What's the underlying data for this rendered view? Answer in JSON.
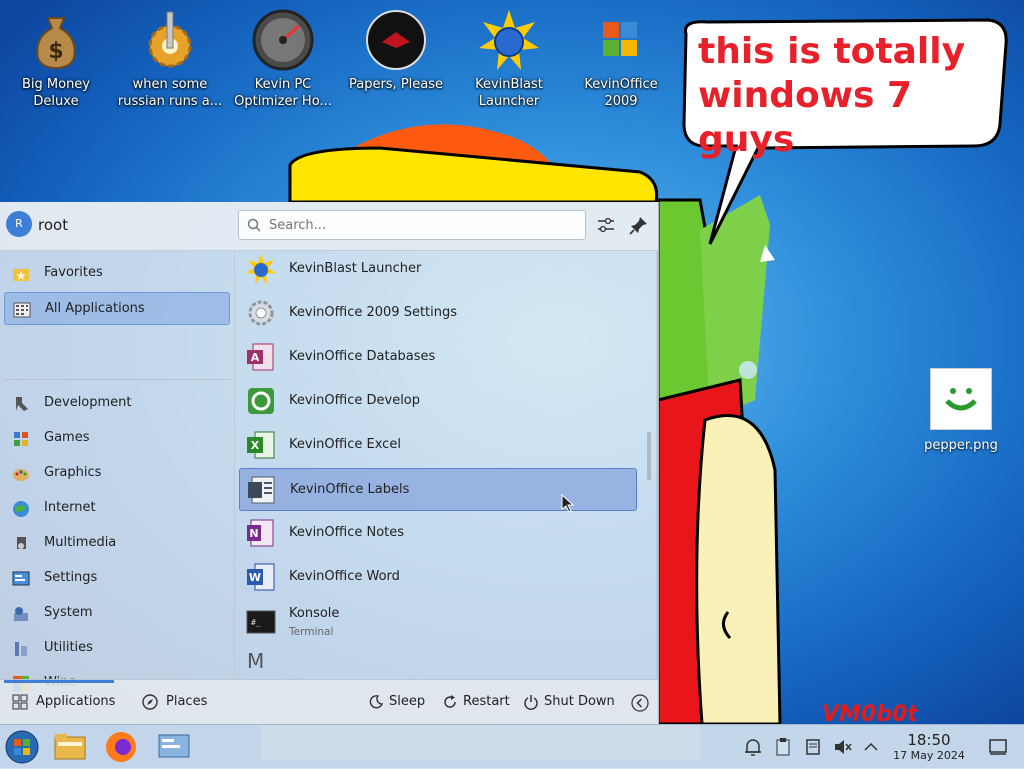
{
  "desktop_icons": [
    {
      "name": "big-money-deluxe-icon",
      "label": "Big Money\nDeluxe"
    },
    {
      "name": "russian-runs-icon",
      "label": "when some\nrussian runs a..."
    },
    {
      "name": "kevin-pc-optimizer-icon",
      "label": "Kevin PC\nOptimizer Ho..."
    },
    {
      "name": "papers-please-icon",
      "label": "Papers, Please"
    },
    {
      "name": "kevinblast-launcher-desktop-icon",
      "label": "KevinBlast\nLauncher"
    },
    {
      "name": "kevinoffice-2009-icon",
      "label": "KevinOffice\n2009"
    }
  ],
  "bubble_text": "this is totally windows 7 guys",
  "pepper_label": "pepper.png",
  "watermark": "VM0b0t",
  "launcher": {
    "user": "root",
    "avatar_letter": "R",
    "search_placeholder": "Search...",
    "categories": [
      {
        "name": "favorites",
        "label": "Favorites",
        "icon": "star-folder-icon",
        "selected": false
      },
      {
        "name": "all-applications",
        "label": "All Applications",
        "icon": "grid-icon",
        "selected": true
      },
      {
        "name": "development",
        "label": "Development",
        "icon": "development-icon",
        "selected": false
      },
      {
        "name": "games",
        "label": "Games",
        "icon": "games-icon",
        "selected": false
      },
      {
        "name": "graphics",
        "label": "Graphics",
        "icon": "graphics-icon",
        "selected": false
      },
      {
        "name": "internet",
        "label": "Internet",
        "icon": "internet-icon",
        "selected": false
      },
      {
        "name": "multimedia",
        "label": "Multimedia",
        "icon": "multimedia-icon",
        "selected": false
      },
      {
        "name": "settings",
        "label": "Settings",
        "icon": "settings-icon",
        "selected": false
      },
      {
        "name": "system",
        "label": "System",
        "icon": "system-icon",
        "selected": false
      },
      {
        "name": "utilities",
        "label": "Utilities",
        "icon": "utilities-icon",
        "selected": false
      },
      {
        "name": "wine",
        "label": "Wine",
        "icon": "wine-icon",
        "selected": false
      }
    ],
    "apps": [
      {
        "label": "KevinBlast Launcher",
        "sub": "",
        "icon": "kevinblast-icon",
        "selected": false
      },
      {
        "label": "KevinOffice 2009 Settings",
        "sub": "",
        "icon": "gear-icon",
        "selected": false
      },
      {
        "label": "KevinOffice Databases",
        "sub": "",
        "icon": "databases-icon",
        "selected": false
      },
      {
        "label": "KevinOffice Develop",
        "sub": "",
        "icon": "develop-icon",
        "selected": false
      },
      {
        "label": "KevinOffice Excel",
        "sub": "",
        "icon": "excel-icon",
        "selected": false
      },
      {
        "label": "KevinOffice Labels",
        "sub": "",
        "icon": "labels-icon",
        "selected": true
      },
      {
        "label": "KevinOffice Notes",
        "sub": "",
        "icon": "notes-icon",
        "selected": false
      },
      {
        "label": "KevinOffice Word",
        "sub": "",
        "icon": "word-icon",
        "selected": false
      },
      {
        "label": "Konsole",
        "sub": "Terminal",
        "icon": "terminal-icon",
        "selected": false
      }
    ],
    "section_letter": "M",
    "tabs": {
      "applications": "Applications",
      "places": "Places"
    },
    "power": {
      "sleep": "Sleep",
      "restart": "Restart",
      "shutdown": "Shut Down"
    }
  },
  "clock": {
    "time": "18:50",
    "date": "17 May 2024"
  },
  "colors": {
    "accent": "#3d7ed6",
    "bubble_text": "#e8202a"
  }
}
